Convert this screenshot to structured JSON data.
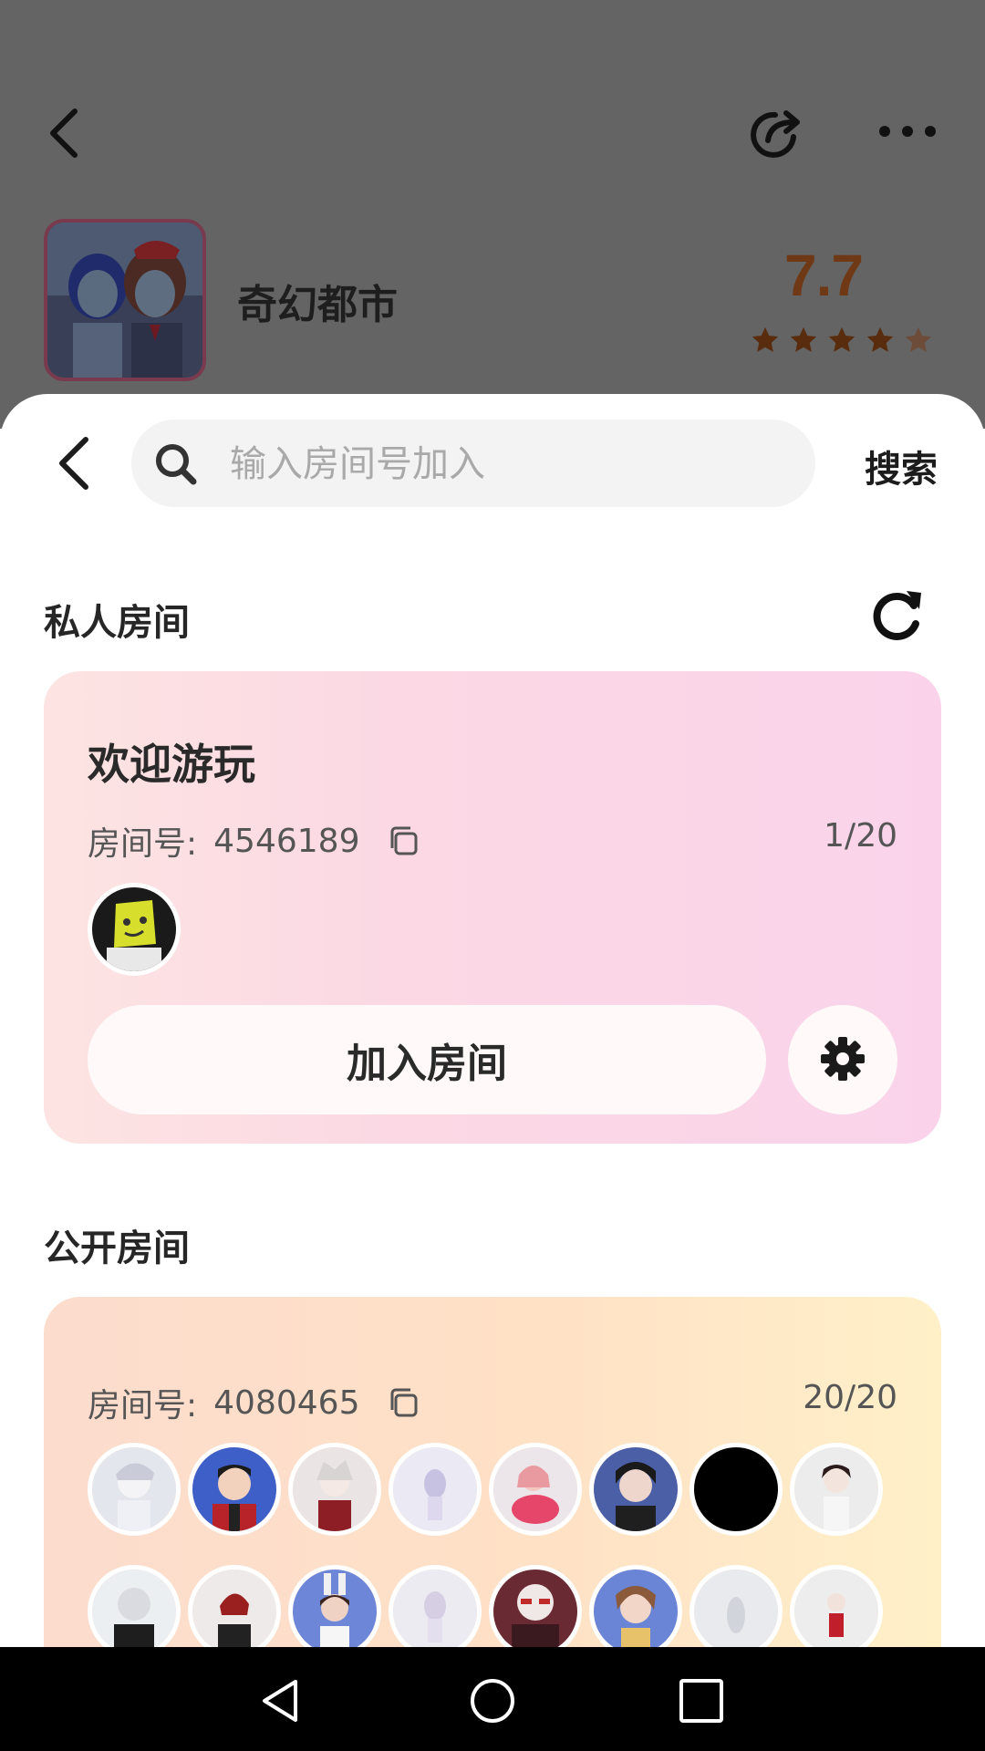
{
  "app": {
    "name": "奇幻都市",
    "rating": "7.7",
    "stars_filled": 4,
    "stars_total": 5,
    "accent": "#6e3914"
  },
  "search": {
    "placeholder": "输入房间号加入",
    "value": "",
    "button_label": "搜索"
  },
  "private_section": {
    "title": "私人房间",
    "room": {
      "name": "欢迎游玩",
      "id_label": "房间号:",
      "id": "4546189",
      "count": "1/20",
      "join_label": "加入房间"
    }
  },
  "public_section": {
    "title": "公开房间",
    "room": {
      "id_label": "房间号:",
      "id": "4080465",
      "count": "20/20"
    }
  },
  "icons": {
    "header_back": "back-arrow",
    "share": "share-icon",
    "more": "more-dots",
    "sheet_back": "back-arrow",
    "search": "magnifier",
    "refresh": "refresh",
    "copy": "copy",
    "settings": "gear"
  }
}
